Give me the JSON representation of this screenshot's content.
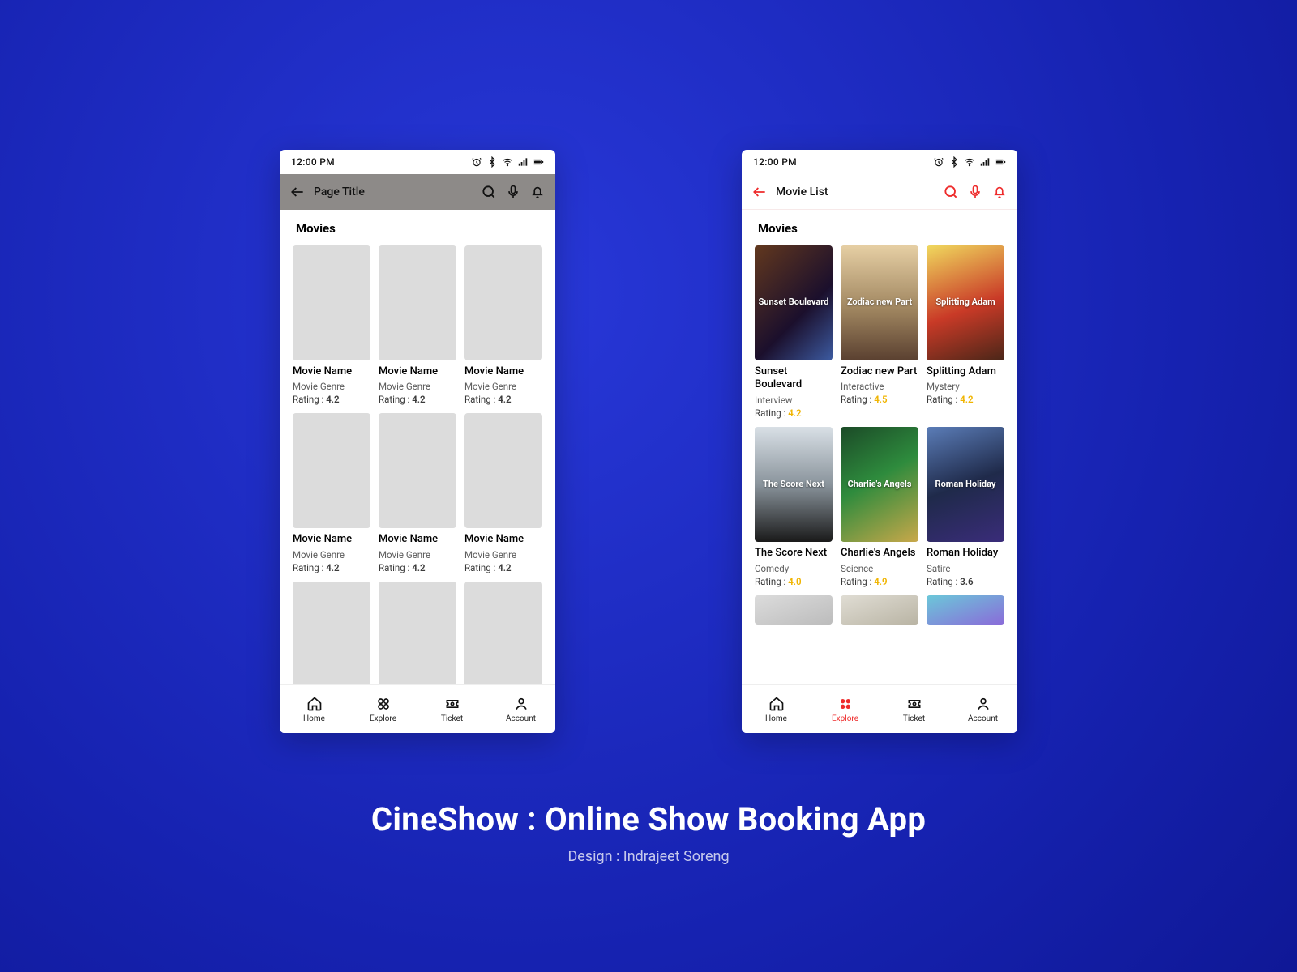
{
  "caption": {
    "title": "CineShow : Online Show Booking App",
    "sub": "Design : Indrajeet Soreng"
  },
  "status": {
    "time": "12:00 PM"
  },
  "left": {
    "title": "Page Title",
    "section": "Movies",
    "item": {
      "name": "Movie Name",
      "genre": "Movie Genre",
      "rating_label": "Rating :",
      "rating": "4.2"
    }
  },
  "right": {
    "title": "Movie List",
    "section": "Movies",
    "rating_label": "Rating :",
    "items": [
      {
        "name": "Sunset Boulevard",
        "genre": "Interview",
        "rating": "4.2",
        "gold": true
      },
      {
        "name": "Zodiac new Part",
        "genre": "Interactive",
        "rating": "4.5",
        "gold": true
      },
      {
        "name": "Splitting Adam",
        "genre": "Mystery",
        "rating": "4.2",
        "gold": true
      },
      {
        "name": "The Score Next",
        "genre": "Comedy",
        "rating": "4.0",
        "gold": true
      },
      {
        "name": "Charlie's Angels",
        "genre": "Science",
        "rating": "4.9",
        "gold": true
      },
      {
        "name": "Roman Holiday",
        "genre": "Satire",
        "rating": "3.6",
        "gold": false
      }
    ]
  },
  "tabs": {
    "home": "Home",
    "explore": "Explore",
    "ticket": "Ticket",
    "account": "Account"
  }
}
